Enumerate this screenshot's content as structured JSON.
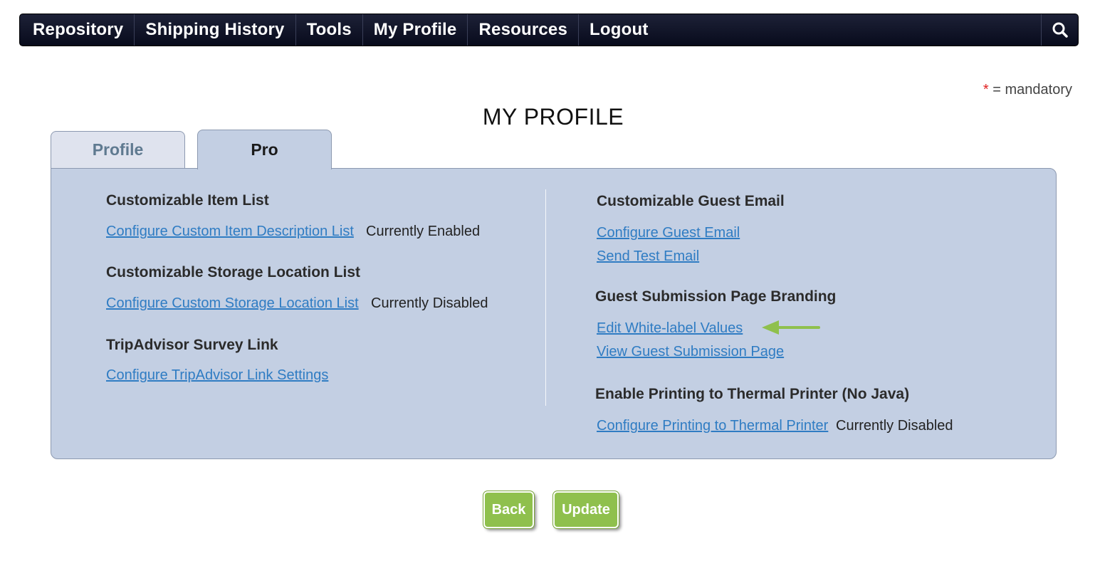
{
  "nav": {
    "items": [
      "Repository",
      "Shipping History",
      "Tools",
      "My Profile",
      "Resources",
      "Logout"
    ],
    "search_icon": "search-icon"
  },
  "mandatory": {
    "star": "*",
    "text": " = mandatory"
  },
  "page_title": "MY PROFILE",
  "tabs": {
    "profile": "Profile",
    "pro": "Pro"
  },
  "left": {
    "item_list": {
      "heading": "Customizable Item List",
      "link": "Configure Custom Item Description List",
      "status": "Currently Enabled"
    },
    "storage_list": {
      "heading": "Customizable Storage Location List",
      "link": "Configure Custom Storage Location List",
      "status": "Currently Disabled"
    },
    "tripadvisor": {
      "heading": "TripAdvisor Survey Link",
      "link": "Configure TripAdvisor Link Settings"
    }
  },
  "right": {
    "guest_email": {
      "heading": "Customizable Guest Email",
      "link_configure": "Configure Guest Email",
      "link_test": "Send Test Email"
    },
    "branding": {
      "heading": "Guest Submission Page Branding",
      "link_edit": "Edit White-label Values",
      "link_view": "View Guest Submission Page"
    },
    "thermal": {
      "heading": "Enable Printing to Thermal Printer (No Java)",
      "link": "Configure Printing to Thermal Printer",
      "status": "Currently Disabled"
    }
  },
  "buttons": {
    "back": "Back",
    "update": "Update"
  },
  "colors": {
    "nav_bg": "#0d1024",
    "panel_bg": "#c3cfe3",
    "link": "#2f7cc3",
    "button": "#8fc04d",
    "arrow": "#8fc04d"
  }
}
